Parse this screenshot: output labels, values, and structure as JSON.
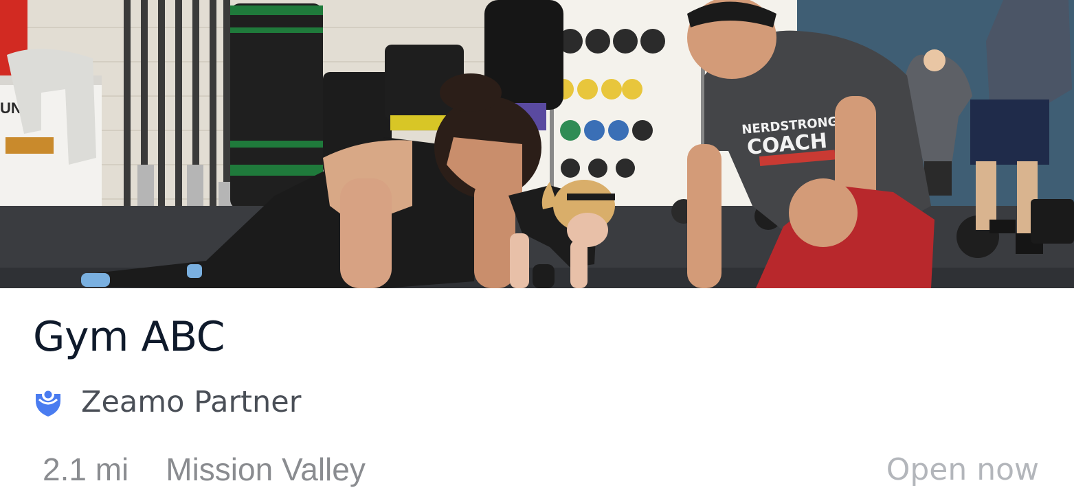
{
  "gym": {
    "name": "Gym ABC",
    "partner_label": "Zeamo Partner",
    "distance": "2.1 mi",
    "neighborhood": "Mission Valley",
    "status": "Open now"
  },
  "photo": {
    "subject": "gym-class-photo",
    "coach_shirt_text": "NERDSTRONG COACH"
  },
  "colors": {
    "title": "#0f1a2b",
    "partner_label": "#4a4f57",
    "partner_icon": "#4a7cf0",
    "meta": "#8a8c90",
    "status": "#b3b6bb"
  },
  "icons": {
    "partner": "location-pin-icon"
  }
}
